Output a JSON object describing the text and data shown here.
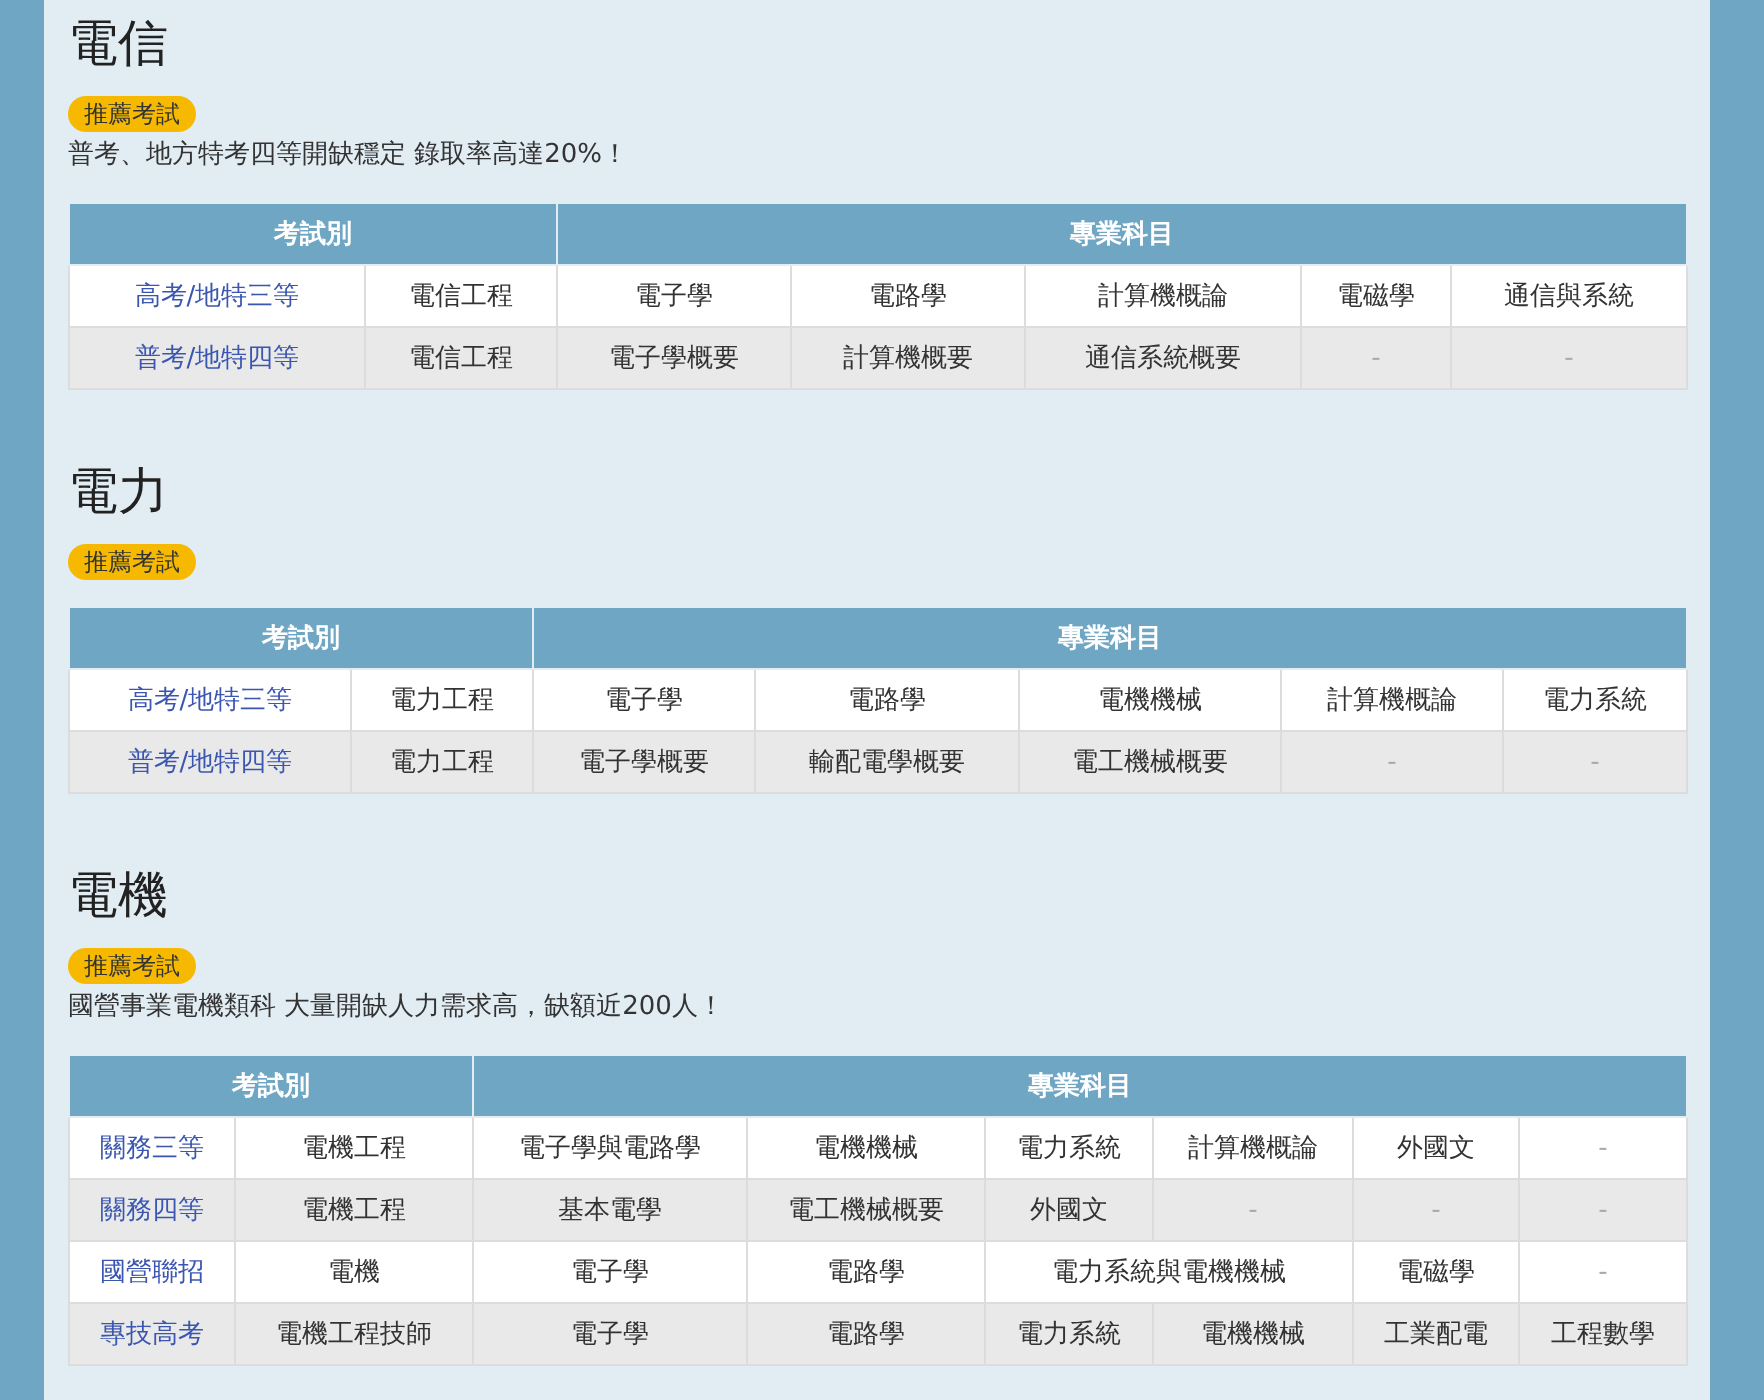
{
  "sections": [
    {
      "title": "電信",
      "badge": "推薦考試",
      "description": "普考、地方特考四等開缺穩定 錄取率高達20%！",
      "table": {
        "headers": [
          "考試別",
          "專業科目"
        ],
        "rows": [
          {
            "exam": "高考/地特三等",
            "cells": [
              {
                "text": "電信工程"
              },
              {
                "text": "電子學"
              },
              {
                "text": "電路學"
              },
              {
                "text": "計算機概論"
              },
              {
                "text": "電磁學"
              },
              {
                "text": "通信與系統"
              }
            ]
          },
          {
            "exam": "普考/地特四等",
            "cells": [
              {
                "text": "電信工程"
              },
              {
                "text": "電子學概要"
              },
              {
                "text": "計算機概要"
              },
              {
                "text": "通信系統概要"
              },
              {
                "text": "-"
              },
              {
                "text": "-"
              }
            ]
          }
        ]
      }
    },
    {
      "title": "電力",
      "badge": "推薦考試",
      "table": {
        "headers": [
          "考試別",
          "專業科目"
        ],
        "rows": [
          {
            "exam": "高考/地特三等",
            "cells": [
              {
                "text": "電力工程"
              },
              {
                "text": "電子學"
              },
              {
                "text": "電路學"
              },
              {
                "text": "電機機械"
              },
              {
                "text": "計算機概論"
              },
              {
                "text": "電力系統"
              }
            ]
          },
          {
            "exam": "普考/地特四等",
            "cells": [
              {
                "text": "電力工程"
              },
              {
                "text": "電子學概要"
              },
              {
                "text": "輸配電學概要"
              },
              {
                "text": "電工機械概要"
              },
              {
                "text": "-"
              },
              {
                "text": "-"
              }
            ]
          }
        ]
      }
    },
    {
      "title": "電機",
      "badge": "推薦考試",
      "description": "國營事業電機類科 大量開缺人力需求高，缺額近200人！",
      "table": {
        "headers": [
          "考試別",
          "專業科目"
        ],
        "rows": [
          {
            "exam": "關務三等",
            "cells": [
              {
                "text": "電機工程"
              },
              {
                "text": "電子學與電路學"
              },
              {
                "text": "電機機械"
              },
              {
                "text": "電力系統"
              },
              {
                "text": "計算機概論"
              },
              {
                "text": "外國文"
              },
              {
                "text": "-"
              }
            ]
          },
          {
            "exam": "關務四等",
            "cells": [
              {
                "text": "電機工程"
              },
              {
                "text": "基本電學"
              },
              {
                "text": "電工機械概要"
              },
              {
                "text": "外國文"
              },
              {
                "text": "-"
              },
              {
                "text": "-"
              },
              {
                "text": "-"
              }
            ]
          },
          {
            "exam": "國營聯招",
            "cells": [
              {
                "text": "電機"
              },
              {
                "text": "電子學"
              },
              {
                "text": "電路學"
              },
              {
                "text": "電力系統與電機機械",
                "colspan": 2
              },
              {
                "text": "電磁學"
              },
              {
                "text": "-"
              }
            ]
          },
          {
            "exam": "專技高考",
            "cells": [
              {
                "text": "電機工程技師"
              },
              {
                "text": "電子學"
              },
              {
                "text": "電路學"
              },
              {
                "text": "電力系統"
              },
              {
                "text": "電機機械"
              },
              {
                "text": "工業配電"
              },
              {
                "text": "工程數學"
              }
            ]
          }
        ]
      }
    }
  ]
}
